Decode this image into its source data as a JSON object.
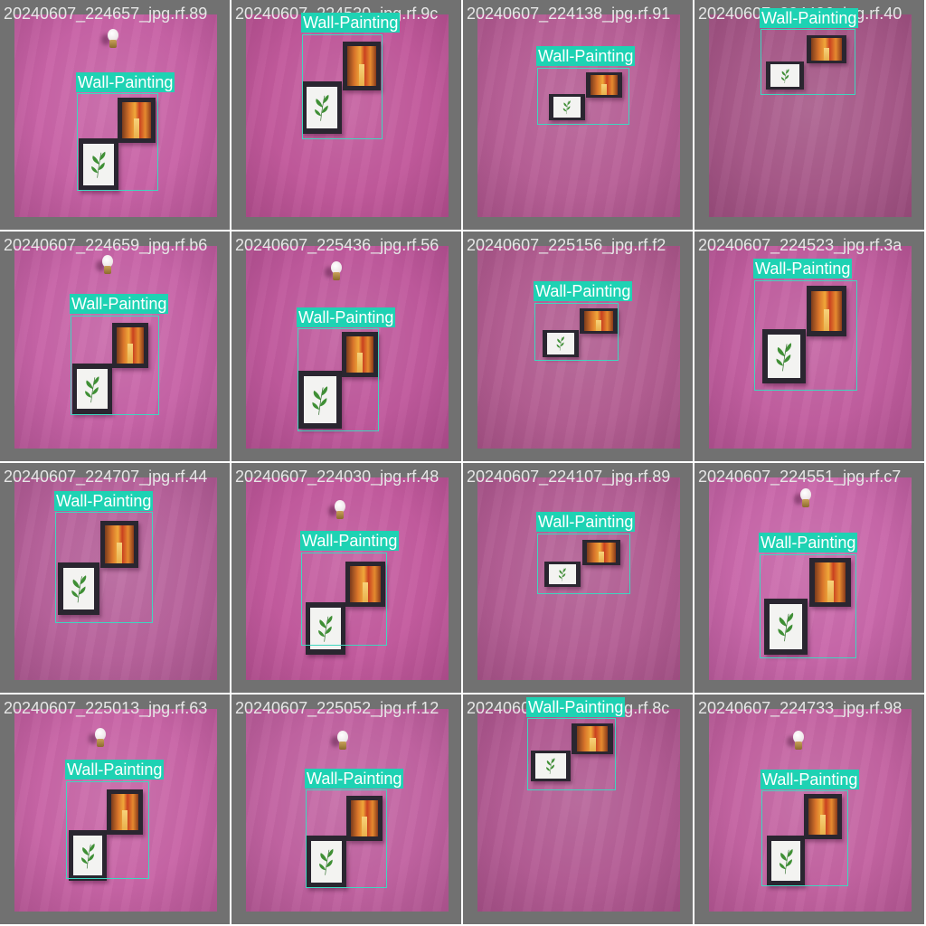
{
  "label": "Wall-Painting",
  "colors": {
    "tile_bg": "#717171",
    "box": "#3fd6bf",
    "tag_bg": "#1ed2b3",
    "wall_pink": "#c45fa2"
  },
  "tiles": [
    {
      "filename": "20240607_224657_jpg.rf.89",
      "wall": "#c863a6"
    },
    {
      "filename": "20240607_224530_jpg.rf.9c",
      "wall": "#c25a9c"
    },
    {
      "filename": "20240607_224138_jpg.rf.91",
      "wall": "#b86097"
    },
    {
      "filename": "20240607_224406_jpg.rf.40",
      "wall": "#a85a8a"
    },
    {
      "filename": "20240607_224659_jpg.rf.b6",
      "wall": "#c764a7"
    },
    {
      "filename": "20240607_225436_jpg.rf.56",
      "wall": "#c05a9d"
    },
    {
      "filename": "20240607_225156_jpg.rf.f2",
      "wall": "#b45f93"
    },
    {
      "filename": "20240607_224523_jpg.rf.3a",
      "wall": "#c25fa0"
    },
    {
      "filename": "20240607_224707_jpg.rf.44",
      "wall": "#b8639c"
    },
    {
      "filename": "20240607_224030_jpg.rf.48",
      "wall": "#c45c9f"
    },
    {
      "filename": "20240607_224107_jpg.rf.89",
      "wall": "#b45f95"
    },
    {
      "filename": "20240607_224551_jpg.rf.c7",
      "wall": "#c968aa"
    },
    {
      "filename": "20240607_225013_jpg.rf.63",
      "wall": "#c865a6"
    },
    {
      "filename": "20240607_225052_jpg.rf.12",
      "wall": "#c264a2"
    },
    {
      "filename": "20240607_224106_jpg.rf.8c",
      "wall": "#b45d95"
    },
    {
      "filename": "20240607_224733_jpg.rf.98",
      "wall": "#c464a2"
    }
  ]
}
